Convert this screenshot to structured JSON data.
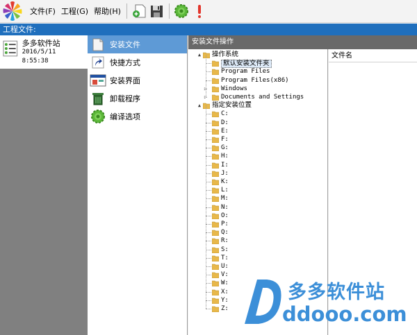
{
  "menu": {
    "items": [
      "文件(F)",
      "工程(G)",
      "帮助(H)"
    ]
  },
  "toolbar": {
    "buttons": [
      "new-icon",
      "save-icon",
      "gear-icon",
      "exclamation-icon"
    ]
  },
  "project": {
    "strip_label": "工程文件:",
    "name": "多多软件站",
    "date": "2016/5/11 8:55:38"
  },
  "nav": {
    "items": [
      {
        "label": "安装文件",
        "icon": "install-files-icon",
        "selected": true
      },
      {
        "label": "快捷方式",
        "icon": "shortcut-icon",
        "selected": false
      },
      {
        "label": "安装界面",
        "icon": "install-ui-icon",
        "selected": false
      },
      {
        "label": "卸载程序",
        "icon": "uninstall-icon",
        "selected": false
      },
      {
        "label": "编译选项",
        "icon": "compile-options-icon",
        "selected": false
      }
    ]
  },
  "ops": {
    "header": "安装文件操作"
  },
  "tree": {
    "os_label": "操作系统",
    "os_children": [
      "默认安装文件夹",
      "Program Files",
      "Program Files(x86)",
      "Windows",
      "Documents and Settings"
    ],
    "custom_label": "指定安装位置",
    "drives": [
      "C:",
      "D:",
      "E:",
      "F:",
      "G:",
      "H:",
      "I:",
      "J:",
      "K:",
      "L:",
      "M:",
      "N:",
      "O:",
      "P:",
      "Q:",
      "R:",
      "S:",
      "T:",
      "U:",
      "V:",
      "W:",
      "X:",
      "Y:",
      "Z:"
    ]
  },
  "files": {
    "column_name": "文件名"
  },
  "watermark": {
    "cn": "多多软件站",
    "en": "ddooo.com"
  },
  "colors": {
    "accent": "#1f6fbd",
    "nav_selected": "#5e9ad6",
    "ops_header": "#696969",
    "watermark": "#3c8fd8"
  }
}
